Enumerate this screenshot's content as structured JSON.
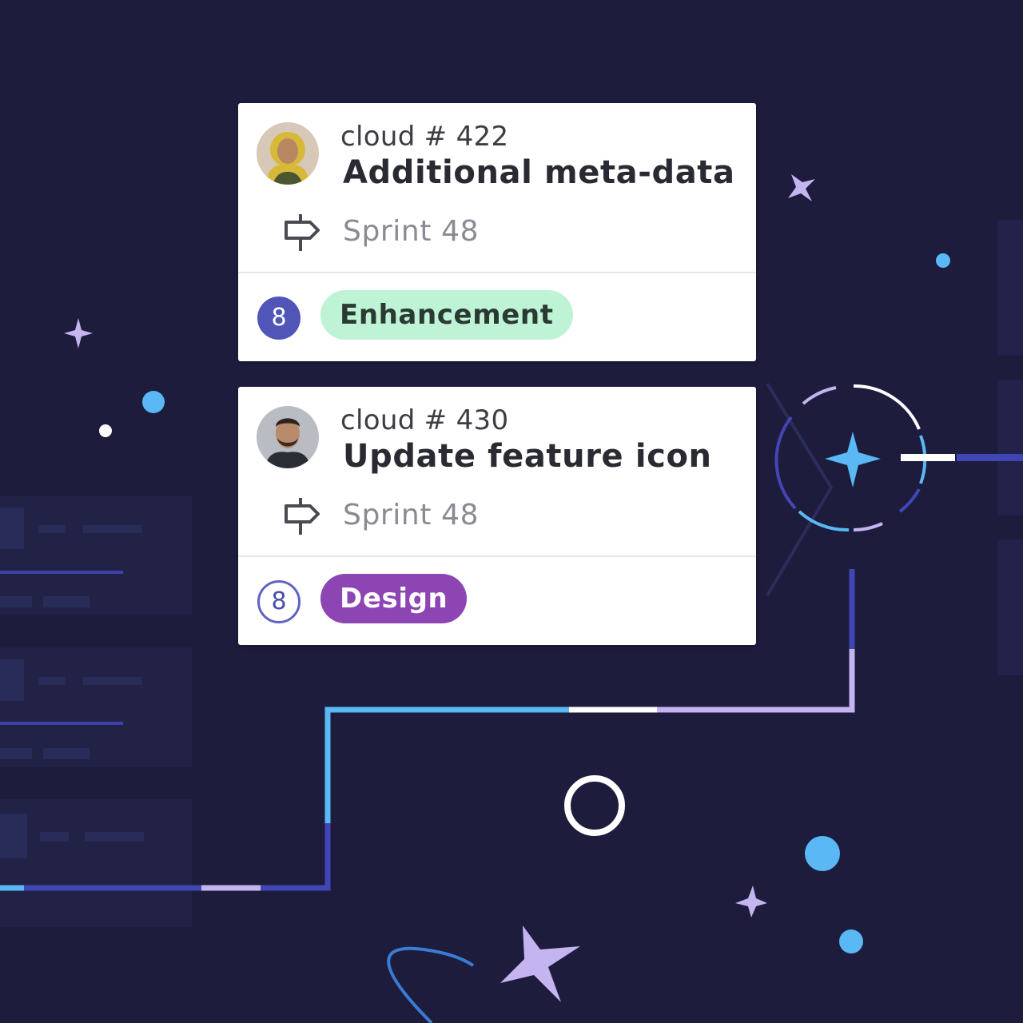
{
  "colors": {
    "background": "#1d1c3d",
    "enhancement_pill": "#bff3d5",
    "design_pill": "#8c45b3",
    "points_badge": "#5155b8",
    "accent_blue": "#5ab8f5",
    "accent_lavender": "#c4b4f0"
  },
  "cards": [
    {
      "ticket_id": "cloud # 422",
      "title": "Additional meta-data",
      "sprint": "Sprint 48",
      "points": "8",
      "label": "Enhancement"
    },
    {
      "ticket_id": "cloud # 430",
      "title": "Update feature icon",
      "sprint": "Sprint 48",
      "points": "8",
      "label": "Design"
    }
  ],
  "icons": {
    "sprint": "signpost-icon",
    "avatar": "avatar",
    "decor": [
      "sparkle-icon",
      "dot-icon",
      "ring-icon"
    ]
  }
}
